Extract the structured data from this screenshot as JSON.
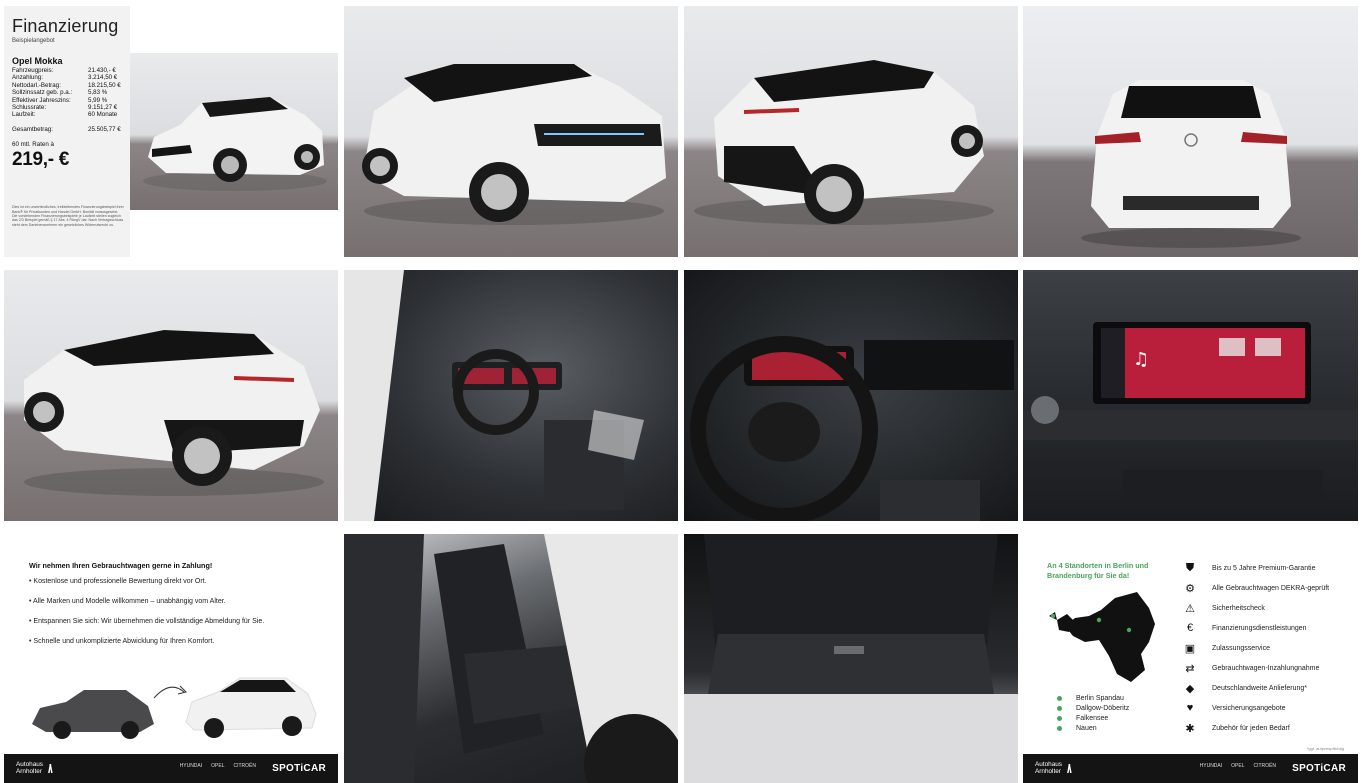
{
  "finance": {
    "title": "Finanzierung",
    "subtitle": "Beispielangebot",
    "model": "Opel Mokka",
    "rows": [
      {
        "label": "Fahrzeugpreis:",
        "value": "21.430,- €"
      },
      {
        "label": "Anzahlung:",
        "value": "3.214,50 €"
      },
      {
        "label": "Nettodarl.-Betrag:",
        "value": "18.215,50 €"
      },
      {
        "label": "Sollzinssatz geb. p.a.:",
        "value": "5,83 %"
      },
      {
        "label": "Effektiver Jahreszins:",
        "value": "5,99 %"
      },
      {
        "label": "Schlussrate:",
        "value": "9.151,27 €"
      },
      {
        "label": "Laufzeit:",
        "value": "60 Monate"
      }
    ],
    "total_label": "Gesamtbetrag:",
    "total_value": "25.505,77 €",
    "rate_label": "60 mtl. Raten à",
    "rate_value": "219,- €",
    "fine_print": "Dies ist ein unverbindliches, freibleibendes Finanzierungsbeispiel ihrer Bank® für Privatkunden und Handel GmbH. Bonität vorausgesetzt. Die vorstehenden Finanzierungsbeispiele je Laufzeit stellen zugleich das 2/3 Beispiel gemäß § 17 Abs. 4 PAngV dar. Nach Vertragsschluss steht dem Darlehensnehmer ein gesetzliches Widerrufsrecht zu."
  },
  "tradein": {
    "heading": "Wir nehmen Ihren Gebrauchtwagen gerne in Zahlung!",
    "items": [
      "Kostenlose und professionelle Bewertung direkt vor Ort.",
      "Alle Marken und Modelle willkommen – unabhängig vom Alter.",
      "Entspannen Sie sich: Wir übernehmen die vollständige Abmeldung für Sie.",
      "Schnelle und unkomplizierte Abwicklung für Ihren Komfort."
    ]
  },
  "footer": {
    "dealer_line1": "Autohaus",
    "dealer_line2": "Arnholter",
    "dealer_logo": "/\\",
    "brands": [
      "HYUNDAI",
      "OPEL",
      "CITROËN"
    ],
    "spoticar": "SPOTiCAR"
  },
  "locations": {
    "heading": "An 4 Standorten in Berlin und Brandenburg für Sie da!",
    "places": [
      "Berlin Spandau",
      "Dallgow-Döberitz",
      "Falkensee",
      "Nauen"
    ],
    "services": [
      {
        "icon": "shield-check-icon",
        "label": "Bis zu 5 Jahre Premium-Garantie"
      },
      {
        "icon": "wrench-car-icon",
        "label": "Alle Gebrauchtwagen DEKRA-geprüft"
      },
      {
        "icon": "warning-triangle-icon",
        "label": "Sicherheitscheck"
      },
      {
        "icon": "finance-icon",
        "label": "Finanzierungsdienstleistungen"
      },
      {
        "icon": "car-registration-icon",
        "label": "Zulassungsservice"
      },
      {
        "icon": "trade-in-icon",
        "label": "Gebrauchtwagen-Inzahlungnahme"
      },
      {
        "icon": "germany-map-icon",
        "label": "Deutschlandweite Anlieferung*"
      },
      {
        "icon": "insurance-icon",
        "label": "Versicherungsangebote"
      },
      {
        "icon": "accessories-icon",
        "label": "Zubehör für jeden Bedarf"
      }
    ],
    "note": "*ggf. aufpreispflichtig"
  },
  "colors": {
    "accent_green": "#49a55c",
    "footer_bg": "#141414",
    "car_body": "#f1f1f1",
    "car_roof": "#151515"
  }
}
